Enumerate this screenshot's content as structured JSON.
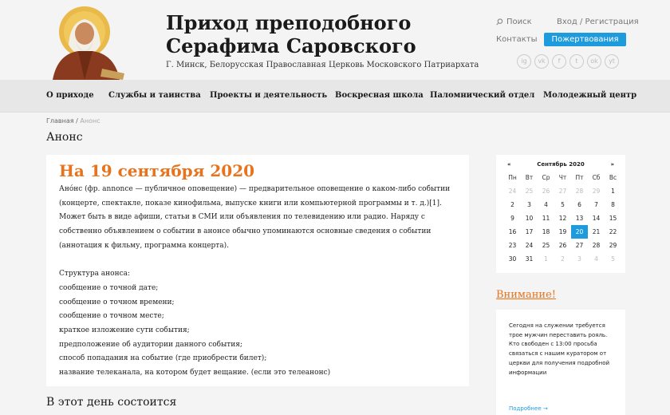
{
  "header": {
    "title_line1": "Приход преподобного",
    "title_line2": "Серафима Саровского",
    "subtitle": "Г. Минск, Белорусская Православная Церковь Московского Патриархата",
    "search": "Поиск",
    "login": "Вход / Регистрация",
    "contacts": "Контакты",
    "donate": "Пожертвования",
    "socials": [
      "ig",
      "vk",
      "f",
      "t",
      "ok",
      "yt"
    ]
  },
  "nav": {
    "items": [
      "О приходе",
      "Службы и таинства",
      "Проекты и деятельность",
      "Воскресная школа",
      "Паломнический отдел",
      "Молодежный центр"
    ]
  },
  "breadcrumb": {
    "home": "Главная",
    "sep": "/",
    "current": "Анонс"
  },
  "page_title": "Анонс",
  "article": {
    "title": "На 19 сентября 2020",
    "paragraph": "Ано́нс (фр. annonce — публичное оповещение) — предварительное оповещение о каком-либо событии (концерте, спектакле, показе кинофильма, выпуске книги или компьютерной программы и т. д.)[1]. Может быть в виде афиши, статьи в СМИ или объявления по телевидению или радио. Наряду с собственно объявлением о событии в анонсе обычно упоминаются основные сведения о событии (аннотация к фильму, программа концерта).",
    "structure_heading": "Структура анонса:",
    "lines": [
      "сообщение о точной дате;",
      "сообщение о точном времени;",
      "сообщение о точном месте;",
      "краткое изложение сути события;",
      "предположение об аудитории данного события;",
      "способ попадания на событие (где приобрести билет);",
      "название телеканала, на котором будет вещание. (если это телеанонс)"
    ]
  },
  "day_title": "В этот день состоится",
  "calendar": {
    "prev": "«",
    "next": "»",
    "month": "Сентябрь 2020",
    "weekdays": [
      "Пн",
      "Вт",
      "Ср",
      "Чт",
      "Пт",
      "Сб",
      "Вс"
    ],
    "days": [
      "24",
      "25",
      "26",
      "27",
      "28",
      "29",
      "1",
      "2",
      "3",
      "4",
      "5",
      "6",
      "7",
      "8",
      "9",
      "10",
      "11",
      "12",
      "13",
      "14",
      "15",
      "16",
      "17",
      "18",
      "19",
      "20",
      "21",
      "22",
      "23",
      "24",
      "25",
      "26",
      "27",
      "28",
      "29",
      "30",
      "31",
      "1",
      "2",
      "3",
      "4",
      "5"
    ],
    "other_month_indices": [
      0,
      1,
      2,
      3,
      4,
      5,
      37,
      38,
      39,
      40,
      41
    ],
    "today_index": 25
  },
  "warning": {
    "title": "Внимание!",
    "text": "Сегодня на служении требуется трое мужчин переставить рояль. Кто свободен с 13:00 просьба связаться с нашим куратором от церкви для получения подробной информации",
    "more": "Подробнее →"
  },
  "colors": {
    "accent": "#e8731c",
    "blue": "#1e9bdc"
  }
}
